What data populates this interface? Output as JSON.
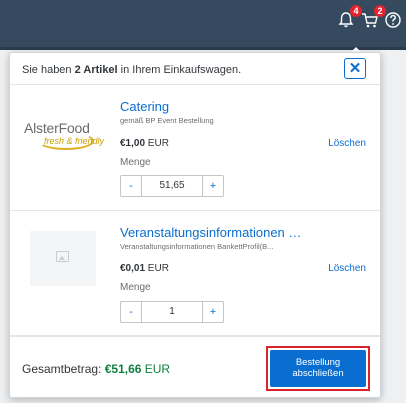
{
  "topbar": {
    "notifications_badge": "4",
    "cart_badge": "2"
  },
  "cart": {
    "header_prefix": "Sie haben ",
    "header_count": "2 Artikel",
    "header_suffix": " in Ihrem Einkaufswagen.",
    "close_label": "✕",
    "items": [
      {
        "logo_main": "AlsterFood",
        "logo_sub": "fresh & friendly",
        "title": "Catering",
        "subtitle": "gemäß BP Event Bestellung",
        "price_amount": "€1,00",
        "price_currency": " EUR",
        "delete_label": "Löschen",
        "qty_label": "Menge",
        "qty_value": "51,65",
        "minus_label": "-",
        "plus_label": "+"
      },
      {
        "title": "Veranstaltungsinformationen Ba...",
        "subtitle": "Veranstaltungsinformationen BankettProfil(B...",
        "price_amount": "€0,01",
        "price_currency": " EUR",
        "delete_label": "Löschen",
        "qty_label": "Menge",
        "qty_value": "1",
        "minus_label": "-",
        "plus_label": "+"
      }
    ],
    "total_label": "Gesamtbetrag: ",
    "total_value": "€51,66",
    "total_currency": " EUR",
    "checkout_line1": "Bestellung",
    "checkout_line2": "abschließen"
  },
  "colors": {
    "shell_bar": "#354a5f",
    "accent": "#0a6ed1",
    "total_green": "#107e3e",
    "highlight_red": "#d9232d"
  }
}
